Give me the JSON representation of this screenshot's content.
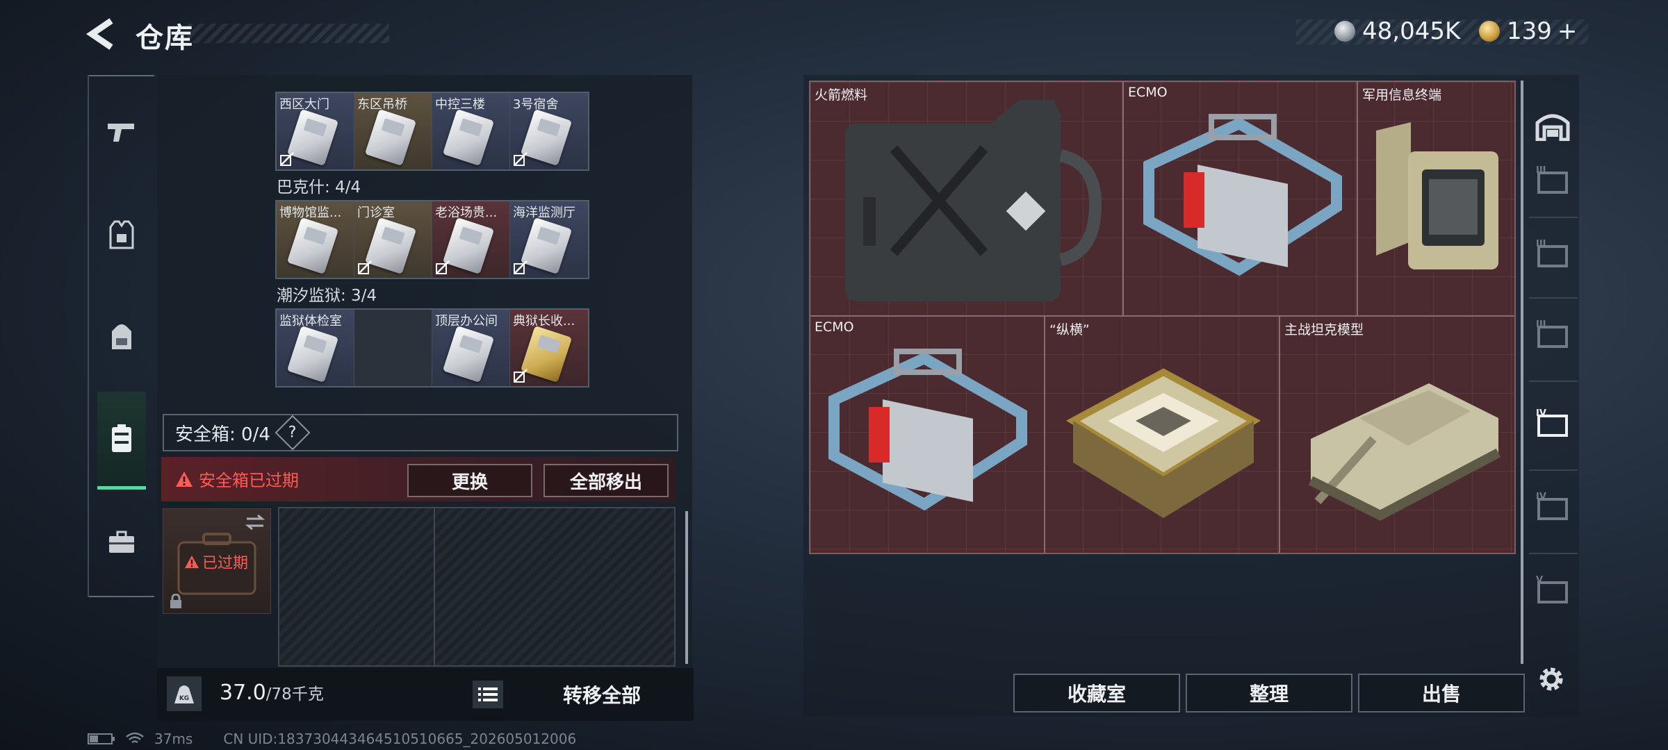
{
  "header": {
    "title": "仓库",
    "currency_1": "48,045K",
    "currency_2": "139",
    "add_label": "+"
  },
  "left_panel": {
    "groups": [
      {
        "title": "",
        "slots": [
          {
            "label": "西区大门",
            "rarity": "blue",
            "locked_out": true
          },
          {
            "label": "东区吊桥",
            "rarity": "gold",
            "locked_out": false
          },
          {
            "label": "中控三楼",
            "rarity": "blue",
            "locked_out": false
          },
          {
            "label": "3号宿舍",
            "rarity": "blue",
            "locked_out": true
          }
        ]
      },
      {
        "title": "巴克什: 4/4",
        "slots": [
          {
            "label": "博物馆监...",
            "rarity": "gold",
            "locked_out": false
          },
          {
            "label": "门诊室",
            "rarity": "gold",
            "locked_out": true
          },
          {
            "label": "老浴场贵...",
            "rarity": "red",
            "locked_out": true
          },
          {
            "label": "海洋监测厅",
            "rarity": "blue",
            "locked_out": true
          }
        ]
      },
      {
        "title": "潮汐监狱: 3/4",
        "slots": [
          {
            "label": "监狱体检室",
            "rarity": "blue",
            "locked_out": false
          },
          {
            "label": "",
            "rarity": "empty",
            "locked_out": false
          },
          {
            "label": "顶层办公间",
            "rarity": "blue",
            "locked_out": false
          },
          {
            "label": "典狱长收...",
            "rarity": "red",
            "locked_out": true
          }
        ]
      }
    ],
    "safe_box": {
      "label": "安全箱: 0/4",
      "help": "?"
    },
    "expired_notice": "安全箱已过期",
    "replace_button": "更换",
    "move_all_out_button": "全部移出",
    "case_status": "已过期",
    "weight_current": "37.0",
    "weight_max": "/78千克",
    "weight_icon_label": "KG",
    "transfer_all_button": "转移全部"
  },
  "items": [
    {
      "name": "火箭燃料",
      "kind": "fuel"
    },
    {
      "name": "ECMO",
      "kind": "ecmo"
    },
    {
      "name": "军用信息终端",
      "kind": "terminal"
    },
    {
      "name": "ECMO",
      "kind": "ecmo"
    },
    {
      "name": "“纵横”",
      "kind": "chess"
    },
    {
      "name": "主战坦克模型",
      "kind": "tank"
    }
  ],
  "right_buttons": {
    "collection": "收藏室",
    "organize": "整理",
    "sell": "出售"
  },
  "right_nav": [
    "",
    "III",
    "III",
    "III",
    "IV",
    "IV",
    "V"
  ],
  "status_bar": {
    "ping": "37ms",
    "uid": "CN UID:183730443464510510665_202605012006"
  },
  "colors": {
    "accent_green": "#5fd4a1",
    "warning_red": "#ff5b55",
    "item_grid_bg": "#4c2b30"
  }
}
